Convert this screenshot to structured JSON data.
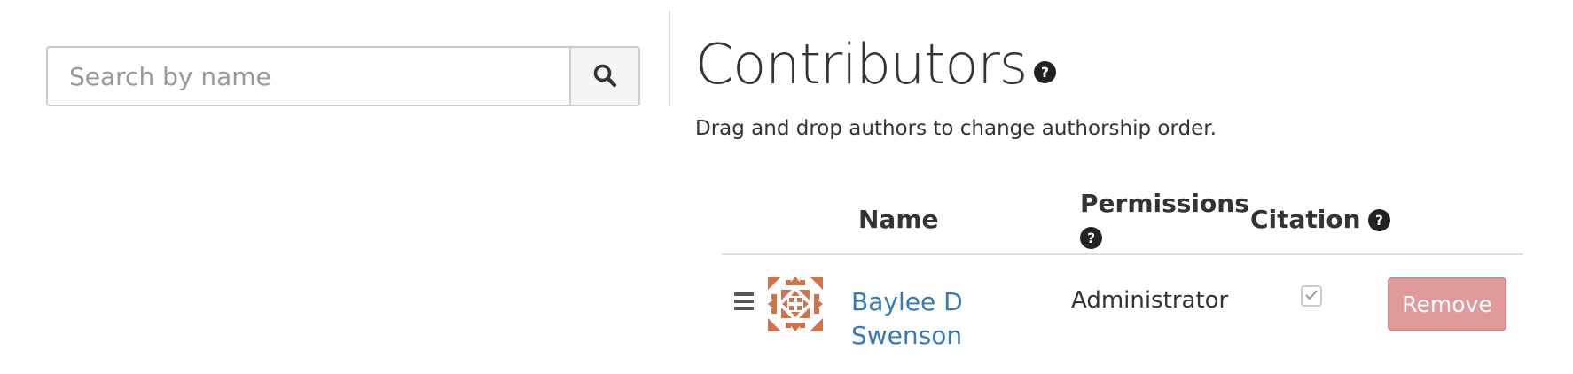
{
  "search": {
    "placeholder": "Search by name",
    "icon": "search-icon"
  },
  "contributors": {
    "title": "Contributors",
    "subtitle": "Drag and drop authors to change authorship order.",
    "columns": {
      "name": "Name",
      "permissions": "Permissions",
      "citation": "Citation"
    },
    "rows": [
      {
        "name_line1": "Baylee D",
        "name_line2": "Swenson",
        "permission": "Administrator",
        "citation_checked": true,
        "remove_label": "Remove"
      }
    ]
  },
  "colors": {
    "link": "#337ab7",
    "remove_button": "#e09a9a",
    "avatar": "#d0734a"
  }
}
